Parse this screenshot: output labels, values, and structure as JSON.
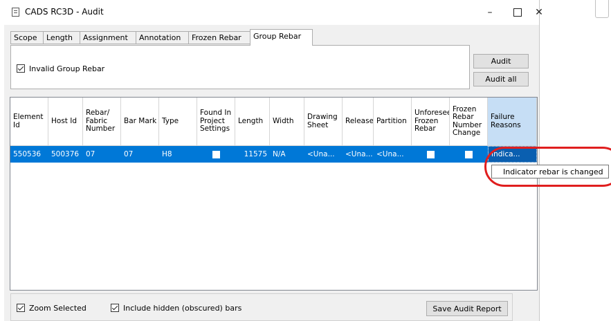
{
  "window": {
    "title": "CADS RC3D - Audit",
    "controls": {
      "minimize": "–",
      "close": "✕"
    }
  },
  "tabs": [
    {
      "label": "Scope",
      "active": false
    },
    {
      "label": "Length",
      "active": false
    },
    {
      "label": "Assignment",
      "active": false
    },
    {
      "label": "Annotation",
      "active": false
    },
    {
      "label": "Frozen Rebar",
      "active": false
    },
    {
      "label": "Group Rebar",
      "active": true
    }
  ],
  "group_rebar_panel": {
    "invalid_group_rebar": {
      "label": "Invalid Group Rebar",
      "checked": true
    }
  },
  "buttons": {
    "audit": "Audit",
    "audit_all": "Audit all",
    "save_report": "Save Audit Report"
  },
  "grid": {
    "columns": [
      "Element Id",
      "Host Id",
      "Rebar/ Fabric Number",
      "Bar Mark",
      "Type",
      "Found In Project Settings",
      "Length",
      "Width",
      "Drawing Sheet",
      "Release",
      "Partition",
      "Unforeseen Frozen Rebar",
      "Frozen Rebar Number Change",
      "Failure Reasons"
    ],
    "rows": [
      {
        "element_id": "550536",
        "host_id": "500376",
        "rebar_number": "07",
        "bar_mark": "07",
        "type": "H8",
        "found_in_settings": false,
        "length": "11575",
        "width": "N/A",
        "drawing_sheet": "<Una...",
        "release": "<Una...",
        "partition": "<Una...",
        "unforeseen_frozen": false,
        "frozen_number_change": false,
        "failure_reasons": "Indica..."
      }
    ]
  },
  "tooltip": "Indicator rebar is changed",
  "options": {
    "zoom_selected": {
      "label": "Zoom Selected",
      "checked": true
    },
    "include_hidden": {
      "label": "Include hidden (obscured) bars",
      "checked": true
    }
  },
  "colors": {
    "selection": "#0078d7",
    "header_selected": "#c6def5",
    "annotation": "#e01e1e"
  }
}
